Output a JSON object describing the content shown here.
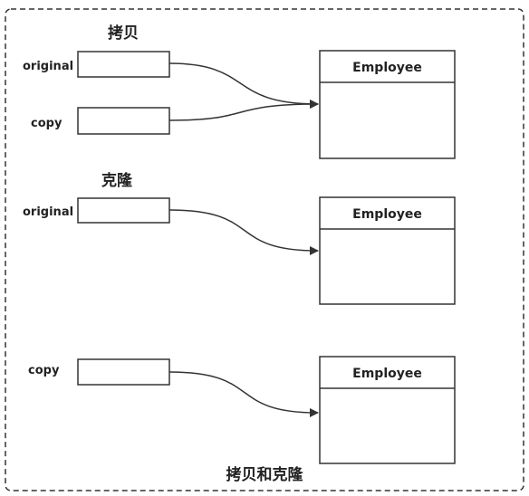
{
  "diagram": {
    "caption": "拷贝和克隆",
    "copy_section": {
      "title": "拷贝",
      "original_label": "original",
      "copy_label": "copy",
      "class_name": "Employee"
    },
    "clone_section": {
      "title": "克隆",
      "original_label": "original",
      "copy_label": "copy",
      "original_class_name": "Employee",
      "copy_class_name": "Employee"
    }
  }
}
